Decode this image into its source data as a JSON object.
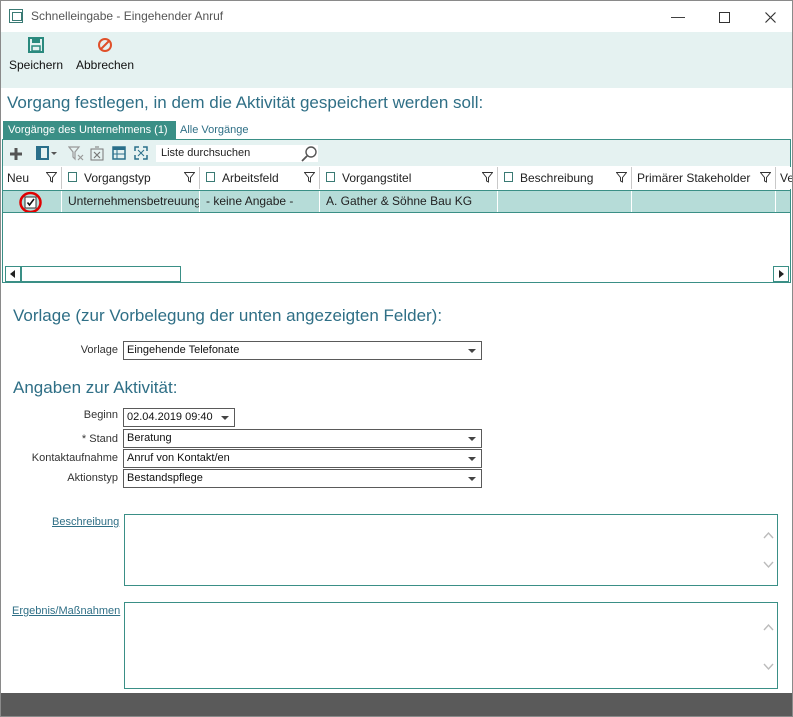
{
  "window": {
    "title": "Schnelleingabe - Eingehender Anruf"
  },
  "toolbar": {
    "save_label": "Speichern",
    "cancel_label": "Abbrechen"
  },
  "section_vorgang": {
    "heading": "Vorgang festlegen, in dem die Aktivität gespeichert werden soll:"
  },
  "tabs": [
    {
      "label": "Vorgänge des Unternehmens (1)",
      "active": true
    },
    {
      "label": "Alle Vorgänge",
      "active": false
    }
  ],
  "grid": {
    "search_placeholder": "Liste durchsuchen",
    "columns": [
      "Neu",
      "Vorgangstyp",
      "Arbeitsfeld",
      "Vorgangstitel",
      "Beschreibung",
      "Primärer Stakeholder",
      "Ve"
    ],
    "rows": [
      {
        "neu": true,
        "vorgangstyp": "Unternehmensbetreuung",
        "arbeitsfeld": "- keine Angabe -",
        "vorgangstitel": "A. Gather & Söhne Bau KG",
        "beschreibung": "",
        "stakeholder": ""
      }
    ]
  },
  "section_vorlage": {
    "heading": "Vorlage (zur Vorbelegung der unten angezeigten Felder):",
    "label": "Vorlage",
    "value": "Eingehende Telefonate"
  },
  "section_aktivitaet": {
    "heading": "Angaben zur Aktivität:",
    "beginn_label": "Beginn",
    "beginn_value": "02.04.2019 09:40",
    "stand_label": "* Stand",
    "stand_value": "Beratung",
    "kontakt_label": "Kontaktaufnahme",
    "kontakt_value": "Anruf von Kontakt/en",
    "aktionstyp_label": "Aktionstyp",
    "aktionstyp_value": "Bestandspflege",
    "beschreibung_label": "Beschreibung",
    "ergebnis_label": "Ergebnis/Maßnahmen"
  },
  "colors": {
    "accent": "#3a8f86",
    "heading": "#2f6f86",
    "toolbar_bg": "#e5f2f1",
    "selected_row": "#b6dcd8",
    "highlight_circle": "#e00000"
  },
  "icons": [
    "app-icon",
    "minimize-icon",
    "maximize-icon",
    "close-icon",
    "save-icon",
    "cancel-icon",
    "add-icon",
    "columns-icon",
    "filter-clear-icon",
    "export-icon",
    "table-icon",
    "expand-icon",
    "search-icon",
    "sort-icon",
    "filter-icon",
    "checkbox-checked-icon",
    "dropdown-arrow-icon",
    "scroll-up-icon",
    "scroll-down-icon",
    "scroll-left-icon",
    "scroll-right-icon"
  ]
}
